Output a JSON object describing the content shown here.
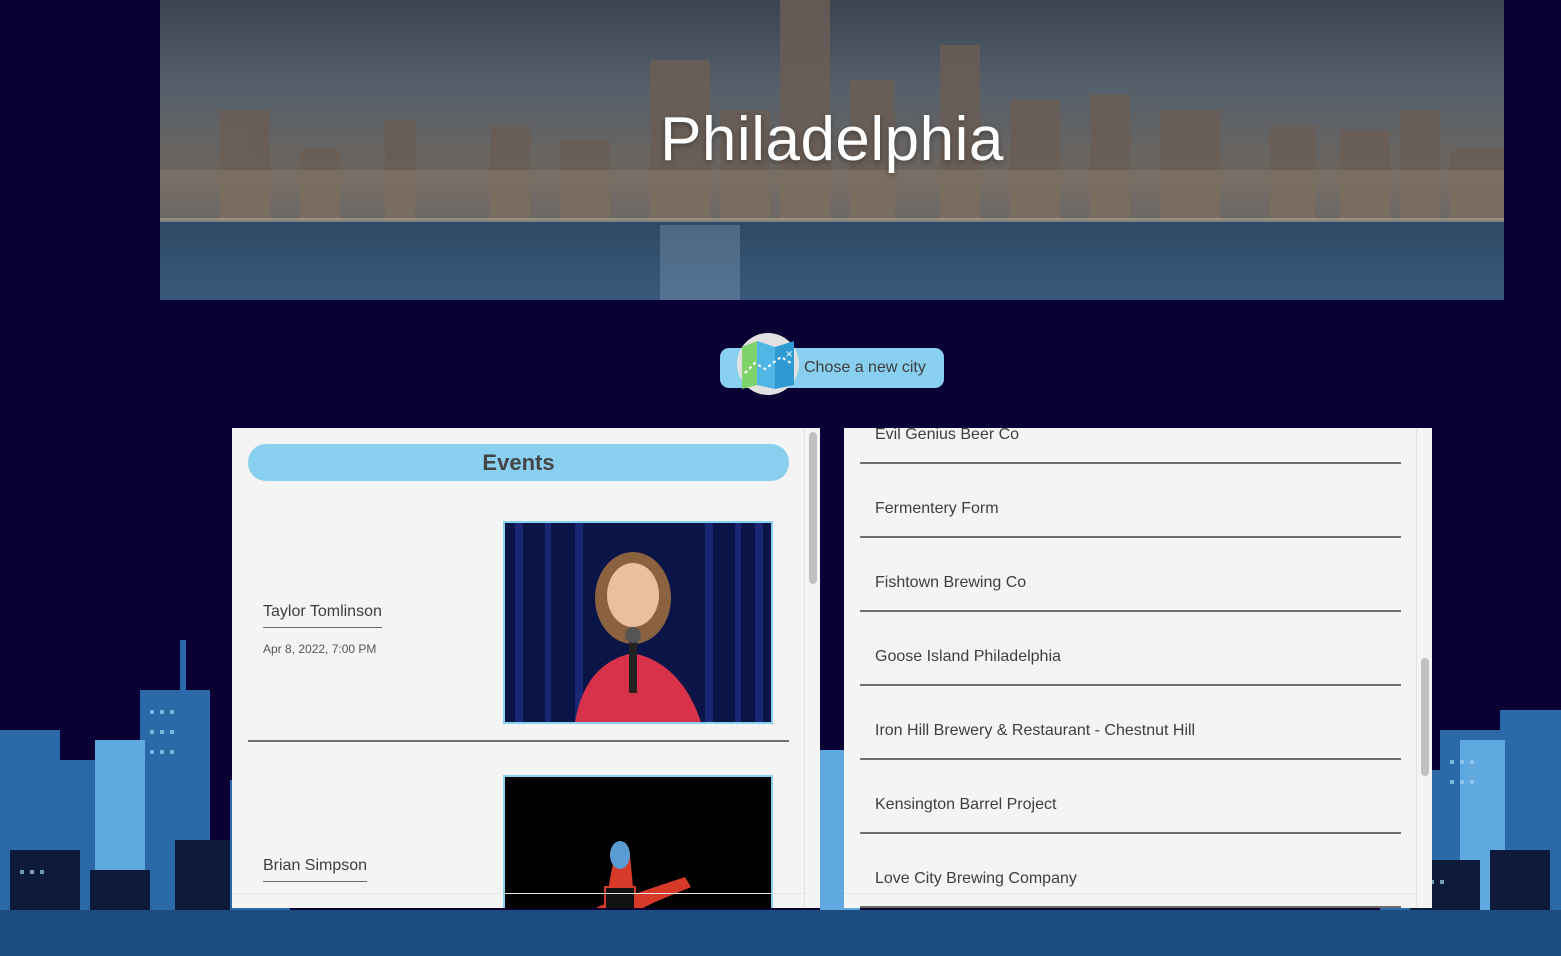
{
  "hero": {
    "city_name": "Philadelphia"
  },
  "city_button": {
    "label": "Chose a new city"
  },
  "events": {
    "header": "Events",
    "items": [
      {
        "name": "Taylor Tomlinson",
        "date": "Apr 8, 2022, 7:00 PM"
      },
      {
        "name": "Brian Simpson",
        "date": ""
      }
    ]
  },
  "places": {
    "items": [
      "Evil Genius Beer Co",
      "Fermentery Form",
      "Fishtown Brewing Co",
      "Goose Island Philadelphia",
      "Iron Hill Brewery & Restaurant - Chestnut Hill",
      "Kensington Barrel Project",
      "Love City Brewing Company"
    ]
  },
  "colors": {
    "page_bg": "#0a0033",
    "accent": "#89cfef",
    "panel_bg": "#f4f4f4"
  }
}
